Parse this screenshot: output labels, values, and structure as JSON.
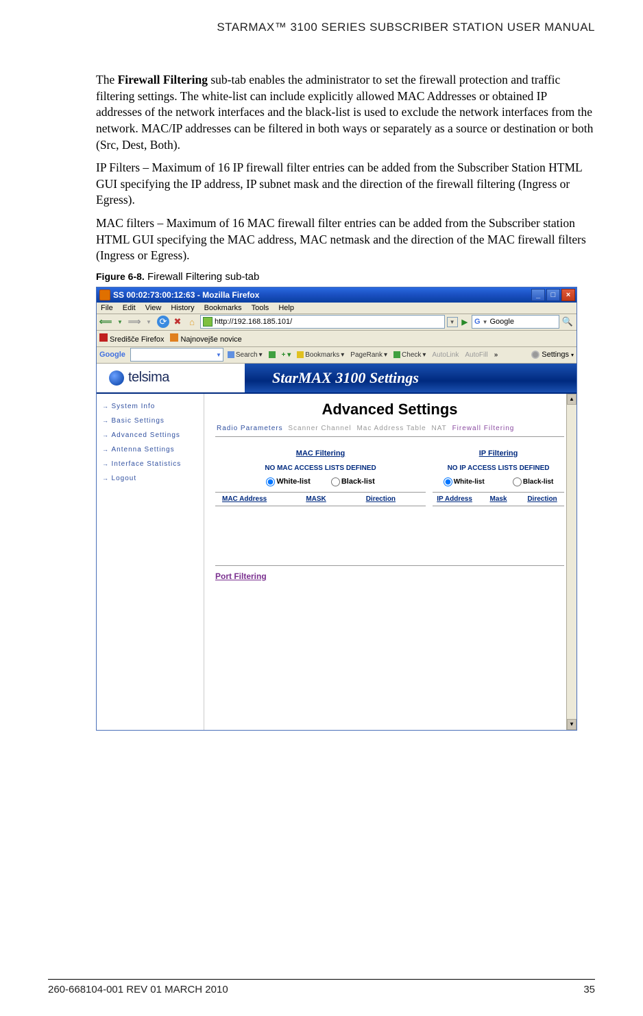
{
  "header": {
    "title": "STARMAX™ 3100 SERIES SUBSCRIBER STATION USER MANUAL"
  },
  "body": {
    "p1_a": "The ",
    "p1_b": "Firewall Filtering",
    "p1_c": " sub-tab enables the administrator to set the firewall protection and traffic filtering settings. The white-list can include explicitly allowed MAC Addresses or obtained IP addresses of the network interfaces and the black-list is used to exclude the network interfaces from the network. MAC/IP addresses can be filtered in both ways or separately as a source or destination or both (Src, Dest, Both).",
    "p2": "IP Filters – Maximum of 16 IP firewall filter entries can be added from the Subscriber Station HTML GUI specifying the IP address, IP subnet mask and the direction of the firewall filtering (Ingress or Egress).",
    "p3": "MAC filters – Maximum of 16 MAC firewall filter entries can be added from the Subscriber station HTML GUI specifying the MAC address, MAC netmask and the direction of the MAC firewall filters (Ingress or Egress).",
    "figlabel": "Figure 6-8.",
    "figtitle": " Firewall Filtering sub-tab"
  },
  "browser": {
    "title": "SS 00:02:73:00:12:63 - Mozilla Firefox",
    "menus": [
      "File",
      "Edit",
      "View",
      "History",
      "Bookmarks",
      "Tools",
      "Help"
    ],
    "url": "http://192.168.185.101/",
    "search_engine": "Google",
    "bookmarks": [
      "Središče Firefox",
      "Najnovejše novice"
    ],
    "google_label": "Google",
    "google_items": [
      "Search",
      "Bookmarks",
      "PageRank",
      "Check",
      "AutoLink",
      "AutoFill"
    ],
    "google_settings": "Settings"
  },
  "app": {
    "logo": "telsima",
    "banner": "StarMAX 3100 Settings",
    "sidebar": [
      "System Info",
      "Basic Settings",
      "Advanced Settings",
      "Antenna Settings",
      "Interface Statistics",
      "Logout"
    ],
    "heading": "Advanced Settings",
    "subtabs": [
      "Radio Parameters",
      "Scanner Channel",
      "Mac Address Table",
      "NAT",
      "Firewall Filtering"
    ],
    "mac": {
      "title": "MAC Filtering",
      "nolist": "NO MAC ACCESS LISTS DEFINED",
      "r1": "White-list",
      "r2": "Black-list",
      "h1": "MAC Address",
      "h2": "MASK",
      "h3": "Direction"
    },
    "ip": {
      "title": "IP Filtering",
      "nolist": "NO IP ACCESS LISTS DEFINED",
      "r1": "White-list",
      "r2": "Black-list",
      "h1": "IP Address",
      "h2": "Mask",
      "h3": "Direction"
    },
    "port": "Port Filtering"
  },
  "footer": {
    "left": "260-668104-001 REV 01 MARCH 2010",
    "right": "35"
  }
}
